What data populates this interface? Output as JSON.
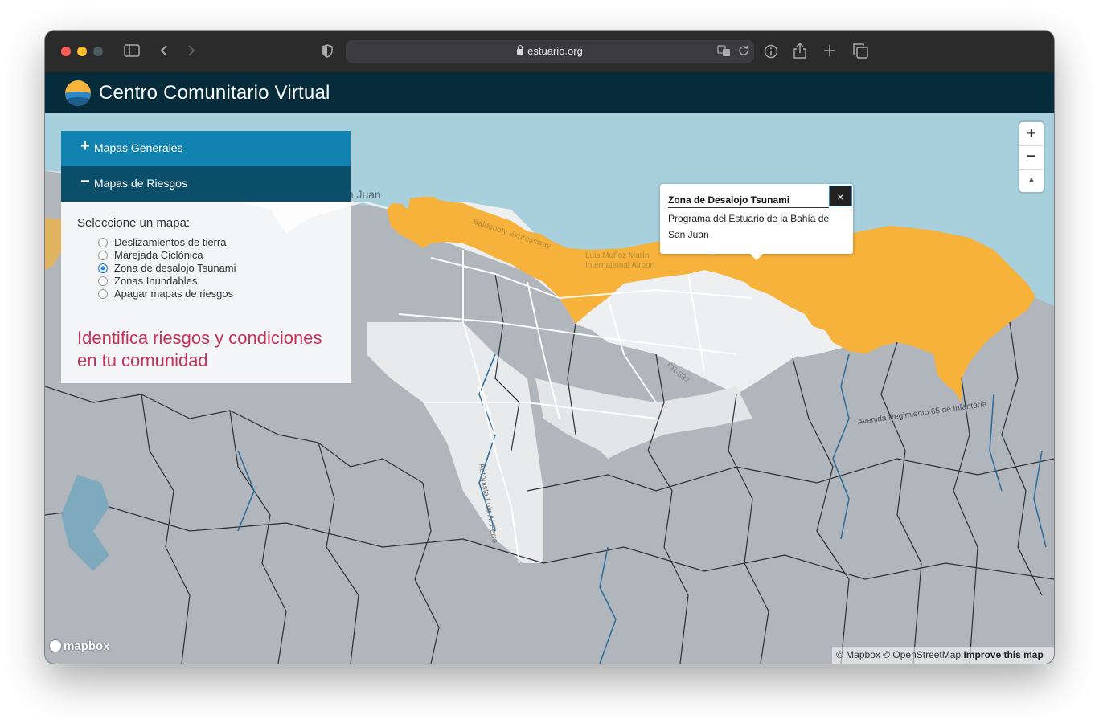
{
  "browser": {
    "url": "estuario.org"
  },
  "app": {
    "title": "Centro Comunitario Virtual"
  },
  "panel": {
    "sections": [
      {
        "sign": "+",
        "label": "Mapas Generales"
      },
      {
        "sign": "−",
        "label": "Mapas de Riesgos"
      }
    ],
    "select_label": "Seleccione un mapa:",
    "options": [
      {
        "label": "Deslizamientos de tierra",
        "selected": false
      },
      {
        "label": "Marejada Ciclónica",
        "selected": false
      },
      {
        "label": "Zona de desalojo Tsunami",
        "selected": true
      },
      {
        "label": "Zonas Inundables",
        "selected": false
      },
      {
        "label": "Apagar mapas de riesgos",
        "selected": false
      }
    ],
    "tagline": "Identifica riesgos y condiciones en tu comunidad"
  },
  "popup": {
    "title": "Zona de Desalojo Tsunami",
    "text": "Programa del Estuario de la Bahía de San Juan",
    "close": "×"
  },
  "map_controls": {
    "zoom_in": "+",
    "zoom_out": "−",
    "compass": "▲"
  },
  "map_labels": {
    "city": "an Juan",
    "airport": "Luis Muñoz Marín International Airport",
    "expressway": "Baldorioty Expressway",
    "pr887": "PR-887",
    "avenida": "Avenida Regimiento 65 de Infantería",
    "autopista": "Autopista Luis A. Ferré"
  },
  "branding": {
    "logo_text": "mapbox"
  },
  "attribution": {
    "mapbox": "© Mapbox",
    "osm": "© OpenStreetMap",
    "improve": "Improve this map"
  },
  "colors": {
    "tsunami_zone": "#f7b23b",
    "water": "#a7cfdc",
    "appbar": "#062b3b",
    "panel_header_active": "#1283b0",
    "panel_header_dark": "#0c4f6a",
    "tagline": "#c5315a"
  }
}
